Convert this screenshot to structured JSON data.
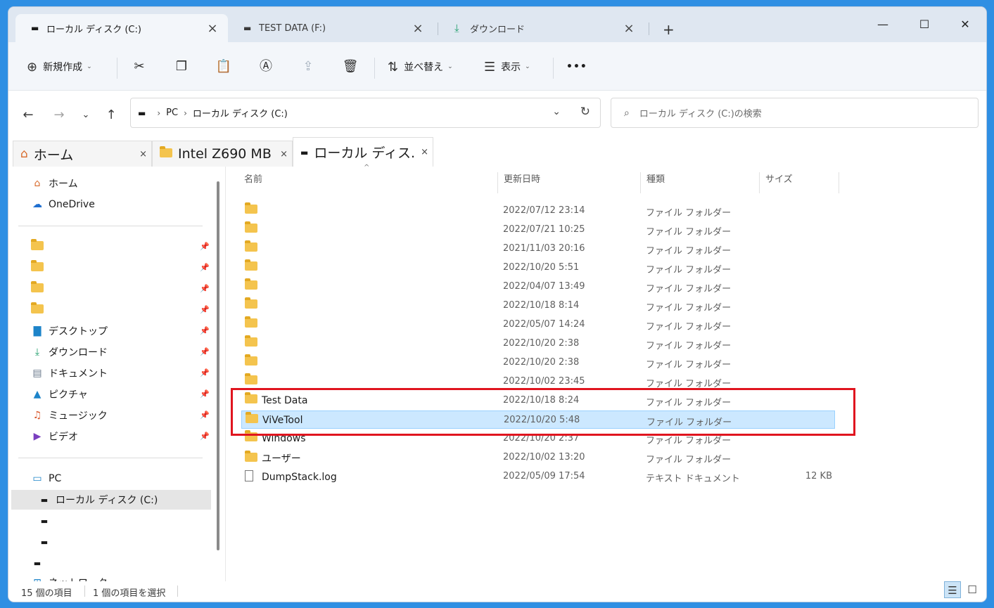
{
  "tabs": [
    {
      "label": "ローカル ディスク (C:)",
      "icon": "drive-icon",
      "active": true
    },
    {
      "label": "TEST DATA (F:)",
      "icon": "drive-icon",
      "active": false
    },
    {
      "label": "ダウンロード",
      "icon": "download-icon",
      "active": false
    }
  ],
  "window_controls": {
    "minimize": "—",
    "maximize": "☐",
    "close": "✕",
    "new_tab": "+"
  },
  "toolbar": {
    "new_label": "新規作成",
    "sort_label": "並べ替え",
    "view_label": "表示",
    "more": "•••"
  },
  "address": {
    "crumbs": [
      "PC",
      "ローカル ディスク (C:)"
    ]
  },
  "search": {
    "placeholder": "ローカル ディスク (C:)の検索"
  },
  "inner_tabs": [
    {
      "label": "ホーム",
      "icon": "home-icon"
    },
    {
      "label": "Intel Z690 MB",
      "icon": "folder-icon"
    },
    {
      "label": "ローカル ディス...",
      "icon": "drive-icon"
    }
  ],
  "sidebar": {
    "top": [
      {
        "label": "ホーム",
        "icon": "home-icon"
      },
      {
        "label": "OneDrive",
        "icon": "cloud-icon"
      }
    ],
    "quick": [
      {
        "label": "",
        "icon": "folder-icon"
      },
      {
        "label": "",
        "icon": "folder-icon"
      },
      {
        "label": "",
        "icon": "folder-icon"
      },
      {
        "label": "",
        "icon": "folder-icon"
      },
      {
        "label": "デスクトップ",
        "icon": "desktop-icon"
      },
      {
        "label": "ダウンロード",
        "icon": "download-icon"
      },
      {
        "label": "ドキュメント",
        "icon": "document-icon"
      },
      {
        "label": "ピクチャ",
        "icon": "pictures-icon"
      },
      {
        "label": "ミュージック",
        "icon": "music-icon"
      },
      {
        "label": "ビデオ",
        "icon": "video-icon"
      }
    ],
    "devices": [
      {
        "label": "PC",
        "icon": "pc-icon"
      },
      {
        "label": "ローカル ディスク (C:)",
        "icon": "drive-icon"
      },
      {
        "label": "",
        "icon": "drive-icon"
      },
      {
        "label": "",
        "icon": "drive-icon"
      },
      {
        "label": "",
        "icon": "drive-icon"
      },
      {
        "label": "ネットワーク",
        "icon": "network-icon"
      }
    ]
  },
  "columns": {
    "name": "名前",
    "date": "更新日時",
    "type": "種類",
    "size": "サイズ"
  },
  "files": [
    {
      "name": "",
      "date": "2022/07/12 23:14",
      "type": "ファイル フォルダー",
      "size": "",
      "kind": "folder"
    },
    {
      "name": "",
      "date": "2022/07/21 10:25",
      "type": "ファイル フォルダー",
      "size": "",
      "kind": "folder"
    },
    {
      "name": "",
      "date": "2021/11/03 20:16",
      "type": "ファイル フォルダー",
      "size": "",
      "kind": "folder"
    },
    {
      "name": "",
      "date": "2022/10/20 5:51",
      "type": "ファイル フォルダー",
      "size": "",
      "kind": "folder"
    },
    {
      "name": "",
      "date": "2022/04/07 13:49",
      "type": "ファイル フォルダー",
      "size": "",
      "kind": "folder"
    },
    {
      "name": "",
      "date": "2022/10/18 8:14",
      "type": "ファイル フォルダー",
      "size": "",
      "kind": "folder"
    },
    {
      "name": "",
      "date": "2022/05/07 14:24",
      "type": "ファイル フォルダー",
      "size": "",
      "kind": "folder"
    },
    {
      "name": "",
      "date": "2022/10/20 2:38",
      "type": "ファイル フォルダー",
      "size": "",
      "kind": "folder"
    },
    {
      "name": "",
      "date": "2022/10/20 2:38",
      "type": "ファイル フォルダー",
      "size": "",
      "kind": "folder"
    },
    {
      "name": "",
      "date": "2022/10/02 23:45",
      "type": "ファイル フォルダー",
      "size": "",
      "kind": "folder"
    },
    {
      "name": "Test Data",
      "date": "2022/10/18 8:24",
      "type": "ファイル フォルダー",
      "size": "",
      "kind": "folder"
    },
    {
      "name": "ViVeTool",
      "date": "2022/10/20 5:48",
      "type": "ファイル フォルダー",
      "size": "",
      "kind": "folder",
      "selected": true
    },
    {
      "name": "Windows",
      "date": "2022/10/20 2:37",
      "type": "ファイル フォルダー",
      "size": "",
      "kind": "folder"
    },
    {
      "name": "ユーザー",
      "date": "2022/10/02 13:20",
      "type": "ファイル フォルダー",
      "size": "",
      "kind": "folder"
    },
    {
      "name": "DumpStack.log",
      "date": "2022/05/09 17:54",
      "type": "テキスト ドキュメント",
      "size": "12 KB",
      "kind": "file"
    }
  ],
  "status": {
    "count": "15 個の項目",
    "selected": "1 個の項目を選択"
  },
  "colors": {
    "accent": "#0078d4",
    "selection": "#cce8ff",
    "highlight": "#e0151f",
    "folder": "#f4c44e"
  }
}
